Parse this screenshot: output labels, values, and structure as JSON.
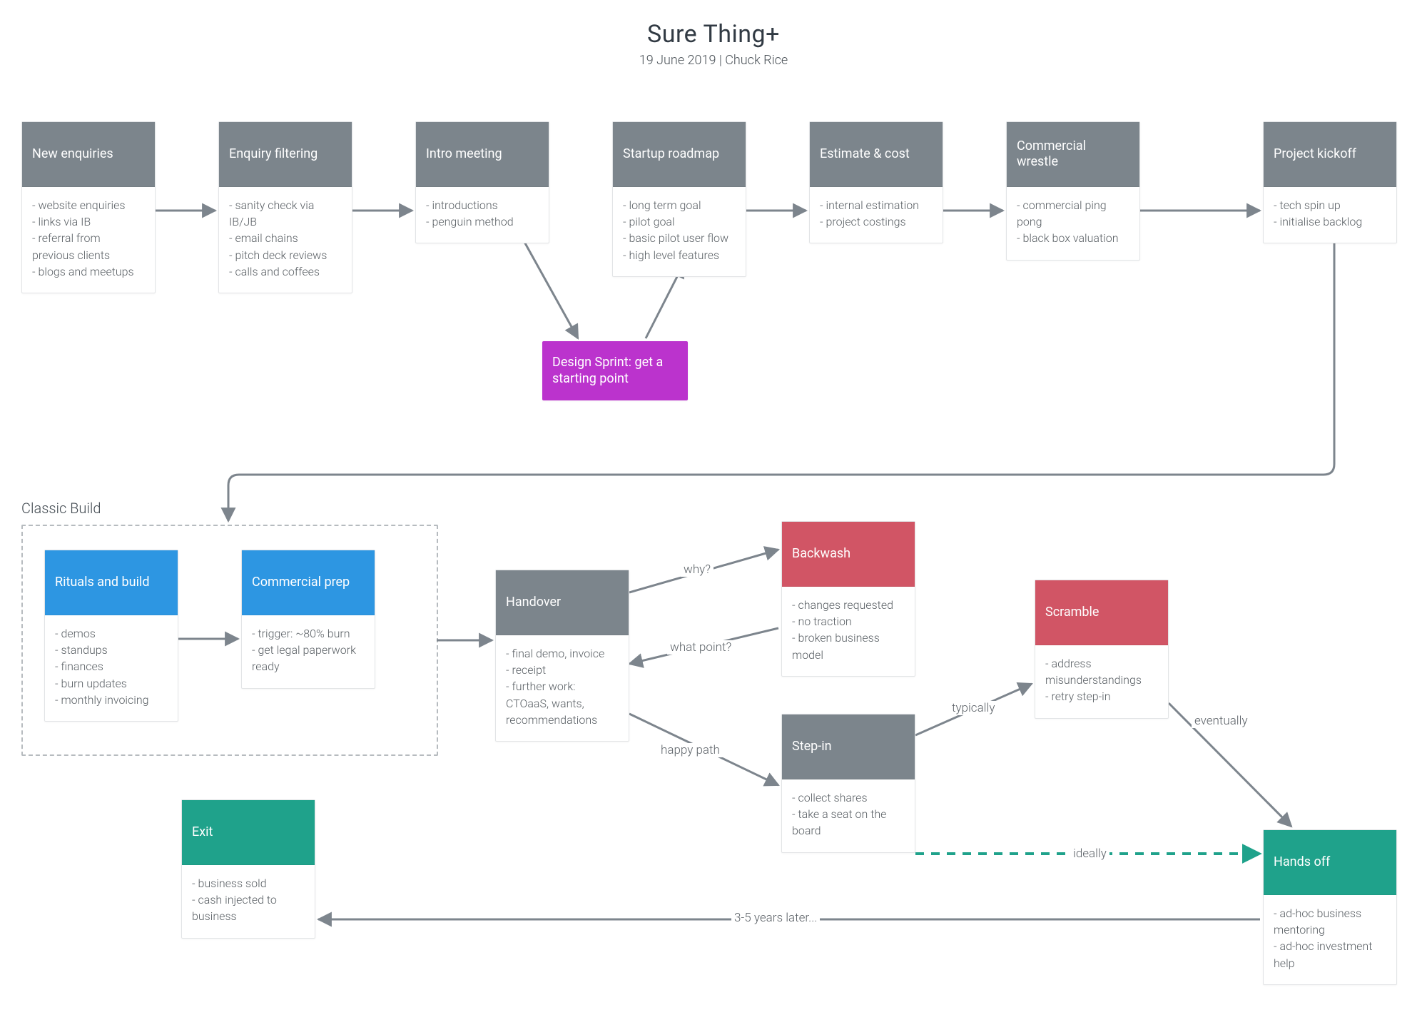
{
  "title": "Sure Thing+",
  "subtitle": "19 June 2019 | Chuck Rice",
  "group": {
    "classic_build": "Classic Build"
  },
  "nodes": {
    "new_enquiries": {
      "label": "New enquiries",
      "items": [
        "website enquiries",
        "links via IB",
        "referral from previous clients",
        "blogs and meetups"
      ]
    },
    "enquiry_filtering": {
      "label": "Enquiry filtering",
      "items": [
        "sanity check via IB/JB",
        "email chains",
        "pitch deck reviews",
        "calls and coffees"
      ]
    },
    "intro_meeting": {
      "label": "Intro meeting",
      "items": [
        "introductions",
        "penguin method"
      ]
    },
    "startup_roadmap": {
      "label": "Startup roadmap",
      "items": [
        "long term goal",
        "pilot goal",
        "basic pilot user flow",
        "high level features"
      ]
    },
    "estimate_cost": {
      "label": "Estimate & cost",
      "items": [
        "internal estimation",
        "project costings"
      ]
    },
    "commercial_wrestle": {
      "label": "Commercial wrestle",
      "items": [
        "commercial ping pong",
        "black box valuation"
      ]
    },
    "project_kickoff": {
      "label": "Project kickoff",
      "items": [
        "tech spin up",
        "initialise backlog"
      ]
    },
    "design_sprint": {
      "label": "Design Sprint: get a starting point"
    },
    "rituals_build": {
      "label": "Rituals and build",
      "items": [
        "demos",
        "standups",
        "finances",
        "burn updates",
        "monthly invoicing"
      ]
    },
    "commercial_prep": {
      "label": "Commercial prep",
      "items": [
        "trigger: ~80% burn",
        "get legal paperwork ready"
      ]
    },
    "handover": {
      "label": "Handover",
      "items": [
        "final demo, invoice",
        "receipt",
        "further work: CTOaaS, wants, recommendations"
      ]
    },
    "backwash": {
      "label": "Backwash",
      "items": [
        "changes requested",
        "no traction",
        "broken business model"
      ]
    },
    "step_in": {
      "label": "Step-in",
      "items": [
        "collect shares",
        "take a seat on the board"
      ]
    },
    "scramble": {
      "label": "Scramble",
      "items": [
        "address misunderstandings",
        "retry step-in"
      ]
    },
    "hands_off": {
      "label": "Hands off",
      "items": [
        "ad-hoc business mentoring",
        "ad-hoc investment help"
      ]
    },
    "exit": {
      "label": "Exit",
      "items": [
        "business sold",
        "cash injected to business"
      ]
    }
  },
  "edge_labels": {
    "why": "why?",
    "what_point": "what point?",
    "happy_path": "happy path",
    "typically": "typically",
    "eventually": "eventually",
    "ideally": "ideally",
    "years_later": "3-5 years later..."
  },
  "colors": {
    "gray": "#7c858c",
    "purple": "#bb33cd",
    "blue": "#2d96e2",
    "red": "#d15565",
    "teal": "#1fa28b",
    "arrow": "#7d858d",
    "dashed": "#1fa28b"
  }
}
